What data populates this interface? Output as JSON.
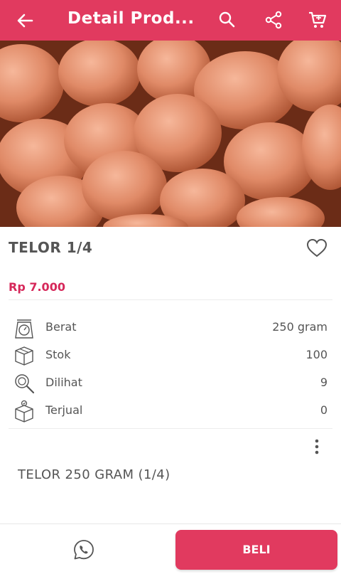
{
  "appbar": {
    "title": "Detail Prod...",
    "icons": [
      "back-arrow-icon",
      "search-icon",
      "share-icon",
      "cart-icon"
    ]
  },
  "product": {
    "name": "TELOR 1/4",
    "price": "Rp 7.000",
    "description": "TELOR 250 GRAM (1/4)"
  },
  "specs": [
    {
      "label": "Berat",
      "value": "250 gram",
      "icon": "scale-icon"
    },
    {
      "label": "Stok",
      "value": "100",
      "icon": "box-icon"
    },
    {
      "label": "Dilihat",
      "value": "9",
      "icon": "view-search-icon"
    },
    {
      "label": "Terjual",
      "value": "0",
      "icon": "sold-box-icon"
    }
  ],
  "actions": {
    "buy_label": "BELI"
  },
  "colors": {
    "accent": "#e13a5f",
    "price": "#d6285a"
  }
}
